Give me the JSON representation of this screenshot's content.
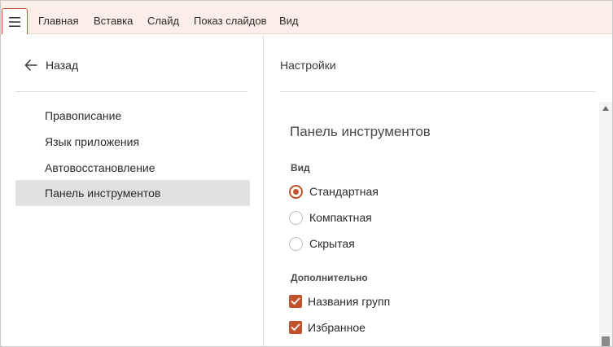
{
  "menubar": {
    "items": [
      {
        "label": "Главная"
      },
      {
        "label": "Вставка"
      },
      {
        "label": "Слайд"
      },
      {
        "label": "Показ слайдов"
      },
      {
        "label": "Вид"
      }
    ]
  },
  "left": {
    "back_label": "Назад",
    "nav": [
      {
        "label": "Правописание"
      },
      {
        "label": "Язык приложения"
      },
      {
        "label": "Автовосстановление"
      },
      {
        "label": "Панель инструментов",
        "active": true
      }
    ]
  },
  "right": {
    "title": "Настройки",
    "section_title": "Панель инструментов",
    "view_group": {
      "label": "Вид",
      "options": [
        {
          "label": "Стандартная",
          "checked": true
        },
        {
          "label": "Компактная",
          "checked": false
        },
        {
          "label": "Скрытая",
          "checked": false
        }
      ]
    },
    "extra_group": {
      "label": "Дополнительно",
      "options": [
        {
          "label": "Названия групп",
          "checked": true
        },
        {
          "label": "Избранное",
          "checked": true
        }
      ]
    }
  },
  "colors": {
    "accent": "#c0532d",
    "menubar_bg": "#faeee6",
    "active_nav_bg": "#e1e1e1"
  }
}
